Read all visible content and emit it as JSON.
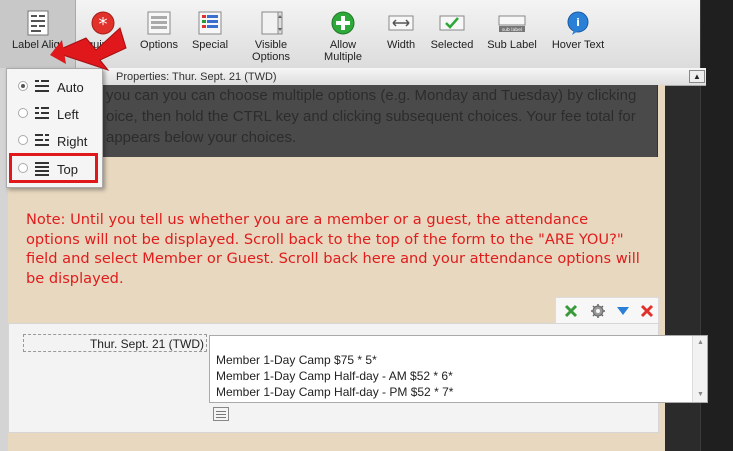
{
  "toolbar": {
    "items": [
      {
        "label": "Label Alig",
        "icon": "label-align-icon"
      },
      {
        "label": "Required",
        "icon": "required-asterisk-icon"
      },
      {
        "label": "Options",
        "icon": "options-list-icon"
      },
      {
        "label": "Special",
        "icon": "special-list-icon"
      },
      {
        "label": "Visible\nOptions",
        "icon": "visible-options-icon"
      },
      {
        "label": "Allow\nMultiple",
        "icon": "add-plus-icon"
      },
      {
        "label": "Width",
        "icon": "width-icon"
      },
      {
        "label": "Selected",
        "icon": "selected-check-icon"
      },
      {
        "label": "Sub Label",
        "icon": "sub-label-icon"
      },
      {
        "label": "Hover Text",
        "icon": "info-icon"
      }
    ],
    "required_visible_fragment": "quired",
    "sub_label_icon_text": "sub label",
    "colors": {
      "required": "#e0312b",
      "plus": "#2fa83a",
      "info": "#2a7fd6"
    }
  },
  "properties": {
    "title": "Properties: Thur. Sept. 21 (TWD)"
  },
  "dropdown": {
    "items": [
      {
        "label": "Auto",
        "selected": true
      },
      {
        "label": "Left",
        "selected": false
      },
      {
        "label": "Right",
        "selected": false
      },
      {
        "label": "Top",
        "selected": false
      }
    ],
    "highlight_color": "#e0181b"
  },
  "form": {
    "intro_text": "you can you can choose multiple options (e.g. Monday and Tuesday) by clicking\noice, then hold the CTRL key and clicking subsequent choices. Your fee total for\nappears below your choices.",
    "note": "Note:   Until you tell us whether you are a member or a guest, the attendance options will not be displayed. Scroll back to the top of the form to the \"ARE YOU?\" field and select Member or Guest.  Scroll back here and your attendance options will be displayed.",
    "note_color": "#e01c1c",
    "field_label": "Thur. Sept. 21 (TWD)",
    "options": [
      "Member 1-Day Camp $75 * 5*",
      "Member 1-Day Camp Half-day - AM $52 * 6*",
      "Member 1-Day Camp Half-day - PM $52 * 7*"
    ]
  }
}
